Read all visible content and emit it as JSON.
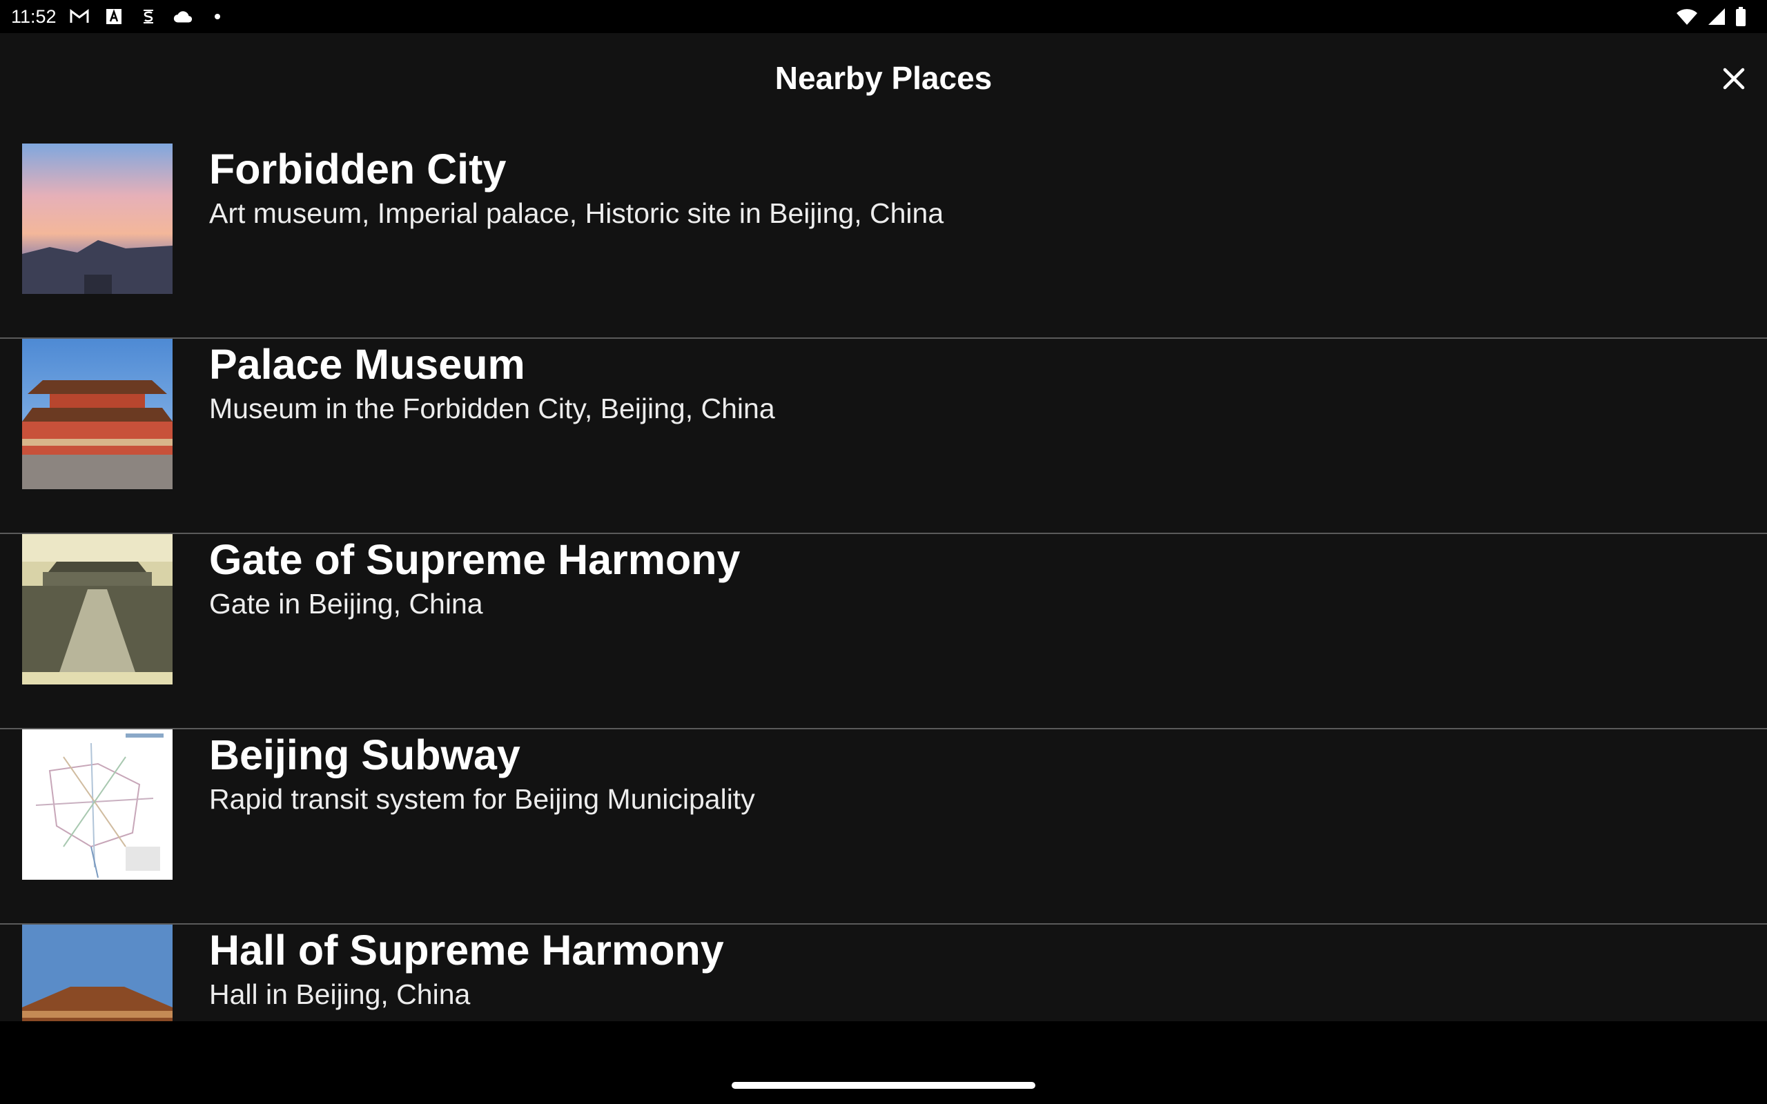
{
  "status_bar": {
    "time": "11:52",
    "left_icons": [
      "gmail-icon",
      "text-a-icon",
      "s-translate-icon",
      "cloud-icon",
      "dot-icon"
    ],
    "right_icons": [
      "wifi-icon",
      "signal-icon",
      "battery-icon"
    ]
  },
  "header": {
    "title": "Nearby Places",
    "close_icon": "close-icon"
  },
  "places": [
    {
      "title": "Forbidden City",
      "description": "Art museum, Imperial palace, Historic site in Beijing, China"
    },
    {
      "title": "Palace Museum",
      "description": "Museum in the Forbidden City, Beijing, China"
    },
    {
      "title": "Gate of Supreme Harmony",
      "description": "Gate in Beijing, China"
    },
    {
      "title": "Beijing Subway",
      "description": "Rapid transit system for Beijing Municipality"
    },
    {
      "title": "Hall of Supreme Harmony",
      "description": "Hall in Beijing, China"
    }
  ],
  "colors": {
    "sheet_background": "#121212",
    "divider": "#5a5a5a",
    "text_primary": "#ffffff"
  }
}
